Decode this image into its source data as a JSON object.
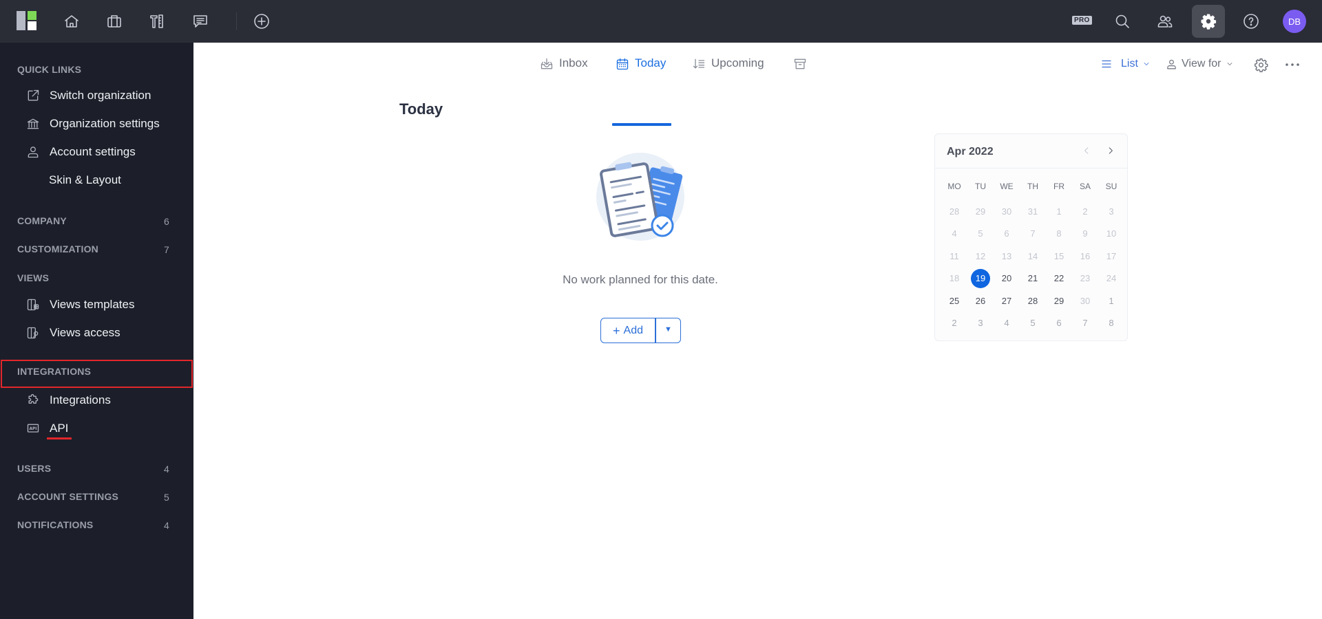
{
  "topbar": {
    "nav_icons": [
      "home-icon",
      "briefcase-icon",
      "tools-icon",
      "chat-icon"
    ],
    "add_icon": "plus-circle-icon",
    "pro_badge": "PRO",
    "right_icons": [
      "search-icon",
      "users-icon",
      "gear-icon",
      "help-icon"
    ],
    "avatar_initials": "DB",
    "avatar_color": "#7b5cf0"
  },
  "sidebar": {
    "quick_links_title": "QUICK LINKS",
    "quick_links": [
      {
        "label": "Switch organization",
        "icon": "external-link-icon"
      },
      {
        "label": "Organization settings",
        "icon": "bank-icon"
      },
      {
        "label": "Account settings",
        "icon": "user-icon"
      },
      {
        "label": "Skin & Layout",
        "icon": ""
      }
    ],
    "sections": {
      "company": {
        "label": "COMPANY",
        "count": "6"
      },
      "customization": {
        "label": "CUSTOMIZATION",
        "count": "7"
      },
      "views": {
        "label": "VIEWS"
      },
      "integrations": {
        "label": "INTEGRATIONS"
      },
      "users": {
        "label": "USERS",
        "count": "4"
      },
      "account_settings": {
        "label": "ACCOUNT SETTINGS",
        "count": "5"
      },
      "notifications": {
        "label": "NOTIFICATIONS",
        "count": "4"
      }
    },
    "views_items": [
      {
        "label": "Views templates",
        "icon": "view-template-icon"
      },
      {
        "label": "Views access",
        "icon": "view-access-icon"
      }
    ],
    "integrations_items": [
      {
        "label": "Integrations",
        "icon": "puzzle-icon"
      },
      {
        "label": "API",
        "icon": "api-icon"
      }
    ],
    "highlight_color": "#e3262b"
  },
  "main": {
    "tabs": [
      {
        "label": "Inbox",
        "icon": "inbox-icon",
        "active": false
      },
      {
        "label": "Today",
        "icon": "calendar-icon",
        "active": true
      },
      {
        "label": "Upcoming",
        "icon": "sort-list-icon",
        "active": false
      },
      {
        "label": "",
        "icon": "archive-icon",
        "active": false
      }
    ],
    "view_mode": "List",
    "view_for": "View for",
    "page_title": "Today",
    "empty_message": "No work planned for this date.",
    "add_label": "Add",
    "accent_color": "#1c6fe0"
  },
  "calendar": {
    "month_label": "Apr 2022",
    "weekdays": [
      "MO",
      "TU",
      "WE",
      "TH",
      "FR",
      "SA",
      "SU"
    ],
    "selected_day": "19",
    "weeks": [
      [
        {
          "d": "28",
          "s": "out"
        },
        {
          "d": "29",
          "s": "out"
        },
        {
          "d": "30",
          "s": "out"
        },
        {
          "d": "31",
          "s": "out"
        },
        {
          "d": "1",
          "s": "past"
        },
        {
          "d": "2",
          "s": "past"
        },
        {
          "d": "3",
          "s": "past"
        }
      ],
      [
        {
          "d": "4",
          "s": "past"
        },
        {
          "d": "5",
          "s": "past"
        },
        {
          "d": "6",
          "s": "past"
        },
        {
          "d": "7",
          "s": "past"
        },
        {
          "d": "8",
          "s": "past"
        },
        {
          "d": "9",
          "s": "past"
        },
        {
          "d": "10",
          "s": "past"
        }
      ],
      [
        {
          "d": "11",
          "s": "past"
        },
        {
          "d": "12",
          "s": "past"
        },
        {
          "d": "13",
          "s": "past"
        },
        {
          "d": "14",
          "s": "past"
        },
        {
          "d": "15",
          "s": "past"
        },
        {
          "d": "16",
          "s": "past"
        },
        {
          "d": "17",
          "s": "past"
        }
      ],
      [
        {
          "d": "18",
          "s": "past"
        },
        {
          "d": "19",
          "s": "sel"
        },
        {
          "d": "20",
          "s": "cur"
        },
        {
          "d": "21",
          "s": "cur"
        },
        {
          "d": "22",
          "s": "cur"
        },
        {
          "d": "23",
          "s": "past"
        },
        {
          "d": "24",
          "s": "past"
        }
      ],
      [
        {
          "d": "25",
          "s": "cur"
        },
        {
          "d": "26",
          "s": "cur"
        },
        {
          "d": "27",
          "s": "cur"
        },
        {
          "d": "28",
          "s": "cur"
        },
        {
          "d": "29",
          "s": "cur"
        },
        {
          "d": "30",
          "s": "past"
        },
        {
          "d": "1",
          "s": "dim"
        }
      ],
      [
        {
          "d": "2",
          "s": "dim"
        },
        {
          "d": "3",
          "s": "dim"
        },
        {
          "d": "4",
          "s": "dim"
        },
        {
          "d": "5",
          "s": "dim"
        },
        {
          "d": "6",
          "s": "dim"
        },
        {
          "d": "7",
          "s": "dim"
        },
        {
          "d": "8",
          "s": "dim"
        }
      ]
    ]
  }
}
